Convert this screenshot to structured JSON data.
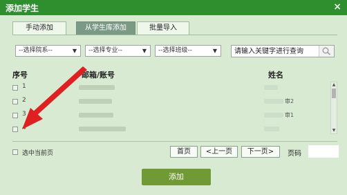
{
  "dialog": {
    "title": "添加学生",
    "close_glyph": "×"
  },
  "tabs": [
    {
      "label": "手动添加",
      "active": false
    },
    {
      "label": "从学生库添加",
      "active": true
    },
    {
      "label": "批量导入",
      "active": false
    }
  ],
  "filters": {
    "college": "--选择院系--",
    "major": "--选择专业--",
    "class": "--选择班级--",
    "search_placeholder": "请输入关键字进行查询"
  },
  "table": {
    "headers": {
      "index": "序号",
      "account": "邮箱/账号",
      "name": "姓名"
    },
    "rows": [
      {
        "index": "1",
        "name_fragment": ""
      },
      {
        "index": "2",
        "name_fragment": "审2"
      },
      {
        "index": "3",
        "name_fragment": "审1"
      },
      {
        "index": "4",
        "name_fragment": ""
      }
    ]
  },
  "footer": {
    "select_page": "选中当前页",
    "first": "首页",
    "prev": "<上一页",
    "next": "下一页>",
    "page_label": "页码"
  },
  "add_button": "添加",
  "colors": {
    "titlebar": "#2f8f2f",
    "dialog_bg": "#d9ead2",
    "active_tab": "#7a9a86",
    "add_button": "#6f9a34",
    "annotation_arrow": "#e02020"
  }
}
